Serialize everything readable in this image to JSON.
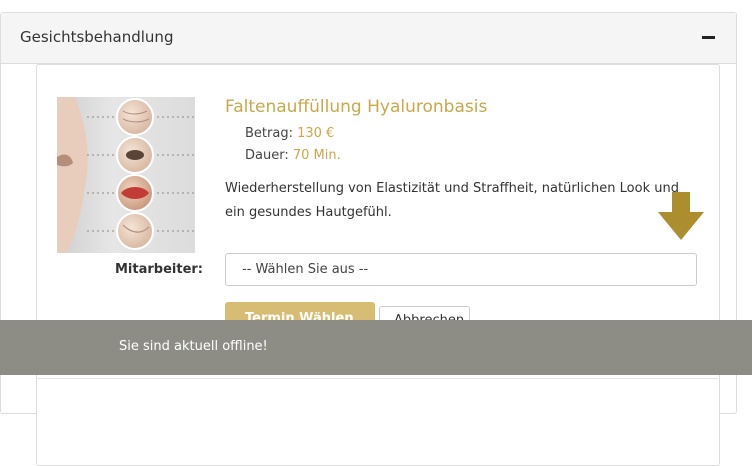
{
  "panel": {
    "title": "Gesichtsbehandlung",
    "collapse_icon": "minus-icon"
  },
  "service": {
    "image_icon": "face-treatment-image",
    "title": "Faltenauffüllung Hyaluronbasis",
    "price_label": "Betrag:",
    "price_value": "130 €",
    "duration_label": "Dauer:",
    "duration_value": "70 Min.",
    "description": "Wiederherstellung von Elastizität und Straffheit, natürlichen Look und ein gesundes Hautgefühl."
  },
  "staff": {
    "label": "Mitarbeiter:",
    "selected": "-- Wählen Sie aus --"
  },
  "buttons": {
    "select_label": "Termin Wählen",
    "cancel_label": "Abbrechen"
  },
  "hint_arrow_icon": "arrow-down-icon",
  "offline": {
    "message": "Sie sind aktuell offline!"
  },
  "colors": {
    "accent": "#c9a84b",
    "button": "#d7bd73",
    "offline_bar": "#8d8d86"
  }
}
